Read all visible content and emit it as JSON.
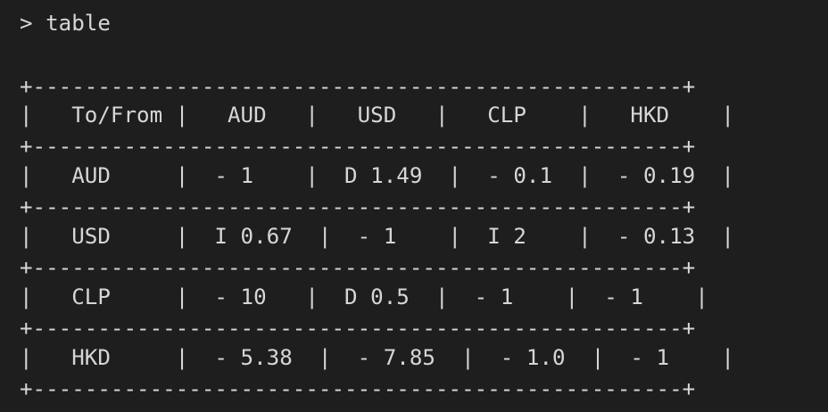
{
  "terminal": {
    "prompt": "> table",
    "lines": [
      "+--------------------------------------------------+",
      "|   To/From |   AUD   |   USD   |   CLP    |   HKD    |",
      "+--------------------------------------------------+",
      "|   AUD     |  - 1    |  D 1.49  |  - 0.1  |  - 0.19  |",
      "+--------------------------------------------------+",
      "|   USD     |  I 0.67  |  - 1    |  I 2    |  - 0.13  |",
      "+--------------------------------------------------+",
      "|   CLP     |  - 10   |  D 0.5  |  - 1    |  - 1    |",
      "+--------------------------------------------------+",
      "|   HKD     |  - 5.38  |  - 7.85  |  - 1.0  |  - 1    |",
      "+--------------------------------------------------+"
    ]
  }
}
